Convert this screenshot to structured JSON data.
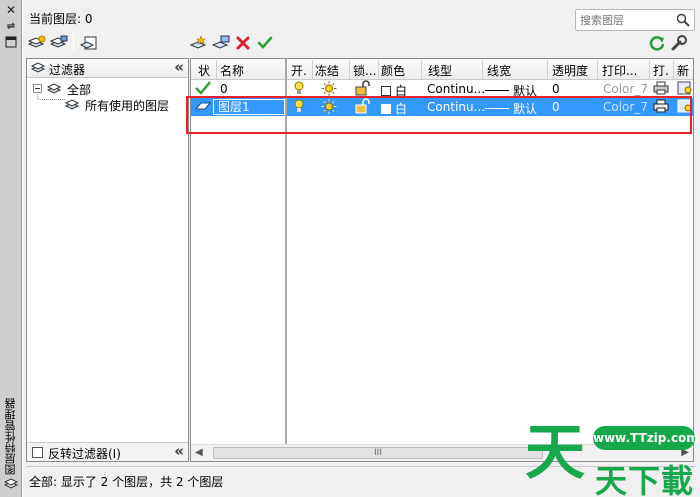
{
  "side": {
    "title": "图层特性管理器"
  },
  "header": {
    "current_layer": "当前图层: 0",
    "search_placeholder": "搜索图层"
  },
  "filter_panel": {
    "title": "过滤器",
    "tree": [
      {
        "label": "全部",
        "level": 0,
        "expanded": true
      },
      {
        "label": "所有使用的图层",
        "level": 1
      }
    ],
    "invert_label": "反转过滤器(I)",
    "invert_checked": false
  },
  "grid": {
    "columns": [
      "状",
      "名称",
      "开.",
      "冻结",
      "锁...",
      "颜色",
      "线型",
      "线宽",
      "透明度",
      "打印...",
      "打.",
      "新"
    ],
    "rows": [
      {
        "status": "current",
        "name": "0",
        "on": true,
        "frozen": false,
        "locked": false,
        "color": "白",
        "linetype": "Continu...",
        "lineweight": "默认",
        "transparency": "0",
        "plot_style": "Color_7",
        "selected": false
      },
      {
        "status": "layer",
        "name": "图层1",
        "on": true,
        "frozen": false,
        "locked": false,
        "color": "白",
        "linetype": "Continu...",
        "lineweight": "默认",
        "transparency": "0",
        "plot_style": "Color_7",
        "selected": true
      }
    ],
    "scroll_grip": "III"
  },
  "status": {
    "text": "全部: 显示了 2 个图层，共 2 个图层"
  },
  "watermark": {
    "url": "www.TTzip.com",
    "big": "天",
    "text": "天下載"
  },
  "colors": {
    "selection": "#3399ff",
    "highlight_box": "#e8202a",
    "watermark_green": "#17a84b"
  }
}
